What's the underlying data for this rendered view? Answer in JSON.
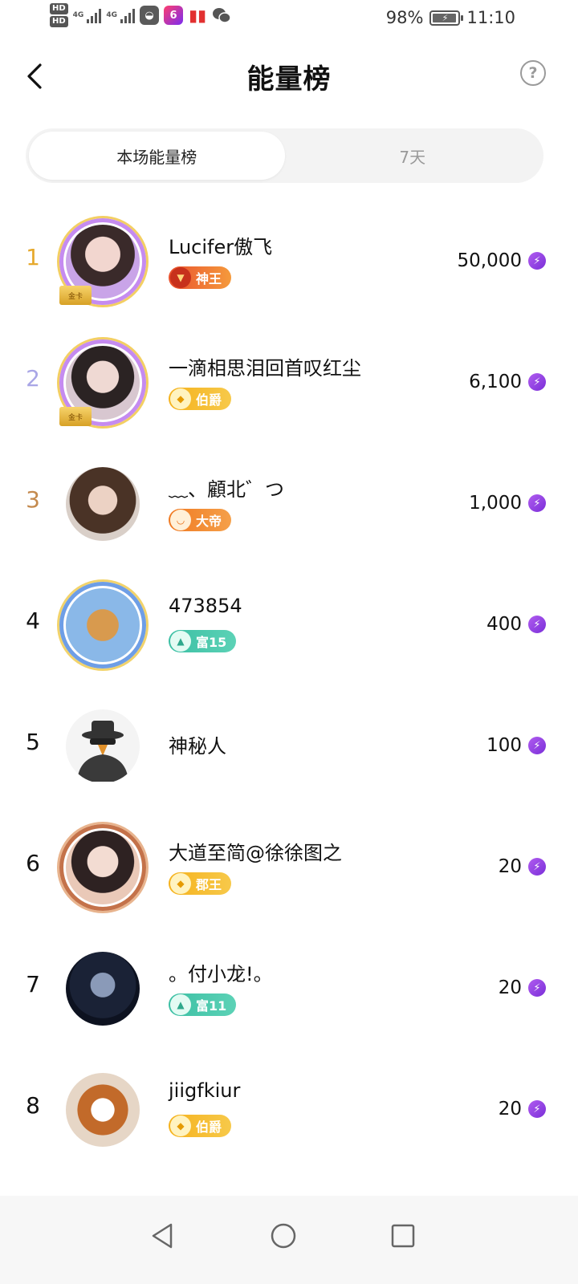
{
  "status_bar": {
    "hd1": "HD",
    "hd2": "HD",
    "net1": "4G",
    "net2": "4G",
    "battery_pct": "98%",
    "time": "11:10",
    "app_badge": "6"
  },
  "header": {
    "title": "能量榜",
    "help_icon": "question-circle-icon"
  },
  "tabs": [
    {
      "label": "本场能量榜",
      "active": true
    },
    {
      "label": "7天",
      "active": false
    }
  ],
  "colors": {
    "rank1": "#e6a92d",
    "rank2": "#a9a6e6",
    "rank3": "#c48a4e",
    "rank_default": "#111111",
    "energy_icon": "#8a3be0"
  },
  "ranking": [
    {
      "rank": "1",
      "name": "Lucifer傲飞",
      "badge": "神王",
      "badge_style": "red",
      "amount": "50,000",
      "card": "金卡"
    },
    {
      "rank": "2",
      "name": "一滴相思泪回首叹红尘",
      "badge": "伯爵",
      "badge_style": "gold",
      "amount": "6,100",
      "card": "金卡"
    },
    {
      "rank": "3",
      "name": "﹏、顧北゛つ",
      "badge": "大帝",
      "badge_style": "orange",
      "amount": "1,000"
    },
    {
      "rank": "4",
      "name": "473854",
      "badge": "富15",
      "badge_style": "teal",
      "amount": "400"
    },
    {
      "rank": "5",
      "name": "神秘人",
      "amount": "100"
    },
    {
      "rank": "6",
      "name": "大道至简@徐徐图之",
      "badge": "郡王",
      "badge_style": "gold",
      "amount": "20"
    },
    {
      "rank": "7",
      "name": "。付小龙!。",
      "badge": "富11",
      "badge_style": "teal",
      "amount": "20"
    },
    {
      "rank": "8",
      "name": "jiigfkiur",
      "badge": "伯爵",
      "badge_style": "gold",
      "amount": "20"
    }
  ]
}
